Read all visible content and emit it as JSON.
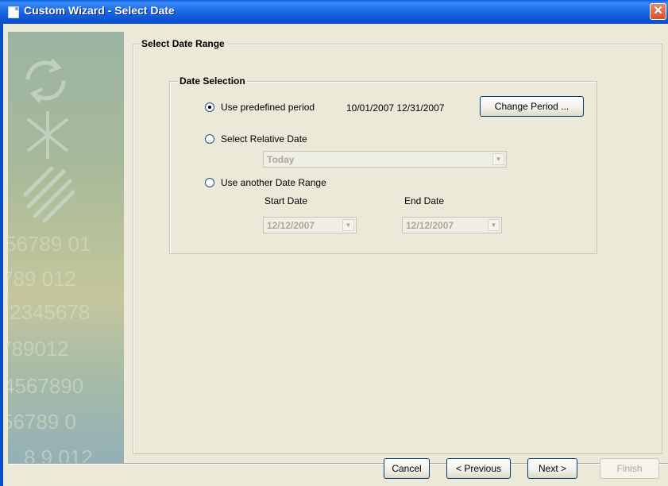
{
  "window": {
    "title": "Custom Wizard - Select Date",
    "close_glyph": "✕"
  },
  "sidebar": {
    "numbers": [
      "56789 01",
      "789 012",
      "2345678",
      "789012",
      "4567890",
      "56789 0",
      "8 9 012"
    ]
  },
  "outer_group": {
    "title": "Select Date Range"
  },
  "date_selection": {
    "title": "Date Selection",
    "options": [
      {
        "label": "Use predefined period",
        "selected": true
      },
      {
        "label": "Select Relative Date",
        "selected": false
      },
      {
        "label": "Use another Date Range",
        "selected": false
      }
    ],
    "predefined_range": "10/01/2007 12/31/2007",
    "change_period_label": "Change Period ...",
    "relative_value": "Today",
    "start_label": "Start Date",
    "end_label": "End Date",
    "start_value": "12/12/2007",
    "end_value": "12/12/2007"
  },
  "buttons": {
    "cancel": "Cancel",
    "previous": "< Previous",
    "next": "Next >",
    "finish": "Finish"
  },
  "icons": {
    "title": "document-icon",
    "close": "close-icon",
    "dropdown": "chevron-down-icon"
  },
  "colors": {
    "titlebar": "#0D55D6",
    "window_bg": "#ECE9D8",
    "close_button": "#D6502B"
  }
}
